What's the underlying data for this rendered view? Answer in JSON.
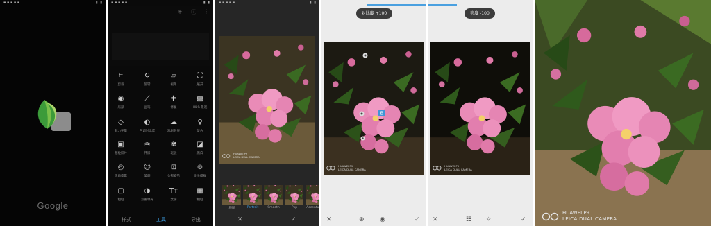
{
  "panel1": {
    "brand": "Google"
  },
  "panel2": {
    "tools": [
      {
        "icon": "crop-icon",
        "glyph": "⌗",
        "label": "剪裁"
      },
      {
        "icon": "rotate-icon",
        "glyph": "↻",
        "label": "旋转"
      },
      {
        "icon": "perspective-icon",
        "glyph": "▱",
        "label": "视角"
      },
      {
        "icon": "expand-icon",
        "glyph": "⛶",
        "label": "展开"
      },
      {
        "icon": "selective-icon",
        "glyph": "◉",
        "label": "局部"
      },
      {
        "icon": "brush-icon",
        "glyph": "⟋",
        "label": "画笔"
      },
      {
        "icon": "healing-icon",
        "glyph": "✚",
        "label": "修复"
      },
      {
        "icon": "hdr-icon",
        "glyph": "▩",
        "label": "HDR 景观"
      },
      {
        "icon": "glamour-glow-icon",
        "glyph": "◇",
        "label": "魅力光晕"
      },
      {
        "icon": "tonal-contrast-icon",
        "glyph": "◐",
        "label": "色调对比度"
      },
      {
        "icon": "drama-icon",
        "glyph": "☁",
        "label": "戏剧效果"
      },
      {
        "icon": "vintage-icon",
        "glyph": "♀",
        "label": "复古"
      },
      {
        "icon": "grainy-film-icon",
        "glyph": "▣",
        "label": "粗粒胶片"
      },
      {
        "icon": "retrolux-icon",
        "glyph": "♒",
        "label": "怀旧"
      },
      {
        "icon": "grunge-icon",
        "glyph": "✾",
        "label": "斑驳"
      },
      {
        "icon": "noir-icon",
        "glyph": "◪",
        "label": "黑白"
      },
      {
        "icon": "black-white-icon",
        "glyph": "◎",
        "label": "黑白电影"
      },
      {
        "icon": "portrait-icon",
        "glyph": "☺",
        "label": "美颜"
      },
      {
        "icon": "head-pose-icon",
        "glyph": "⊡",
        "label": "头部姿势"
      },
      {
        "icon": "lens-blur-icon",
        "glyph": "⊙",
        "label": "镜头模糊"
      },
      {
        "icon": "frames-icon",
        "glyph": "▢",
        "label": "相框"
      },
      {
        "icon": "double-exposure-icon",
        "glyph": "◑",
        "label": "双重曝光"
      },
      {
        "icon": "text-icon",
        "glyph": "Tт",
        "label": "文字"
      },
      {
        "icon": "face-enhance-icon",
        "glyph": "▦",
        "label": "相框"
      }
    ],
    "nav": [
      "样式",
      "工具",
      "导出"
    ],
    "active_nav": "工具"
  },
  "panel3": {
    "filters": [
      "原图",
      "Portrait",
      "Smooth",
      "Pop",
      "Accentuate"
    ],
    "selected_filter": "Portrait",
    "watermark": {
      "line1": "HUAWEI P9",
      "line2": "LEICA DUAL CAMERA"
    }
  },
  "panel4": {
    "pill": "对比度 +100",
    "watermark": {
      "line1": "HUAWEI P9",
      "line2": "LEICA DUAL CAMERA"
    }
  },
  "panel5": {
    "pill": "亮度 -100",
    "watermark": {
      "line1": "HUAWEI P9",
      "line2": "LEICA DUAL CAMERA"
    }
  },
  "panel6": {
    "watermark": {
      "line1": "HUAWEI P9",
      "line2": "LEICA DUAL CAMERA"
    }
  }
}
